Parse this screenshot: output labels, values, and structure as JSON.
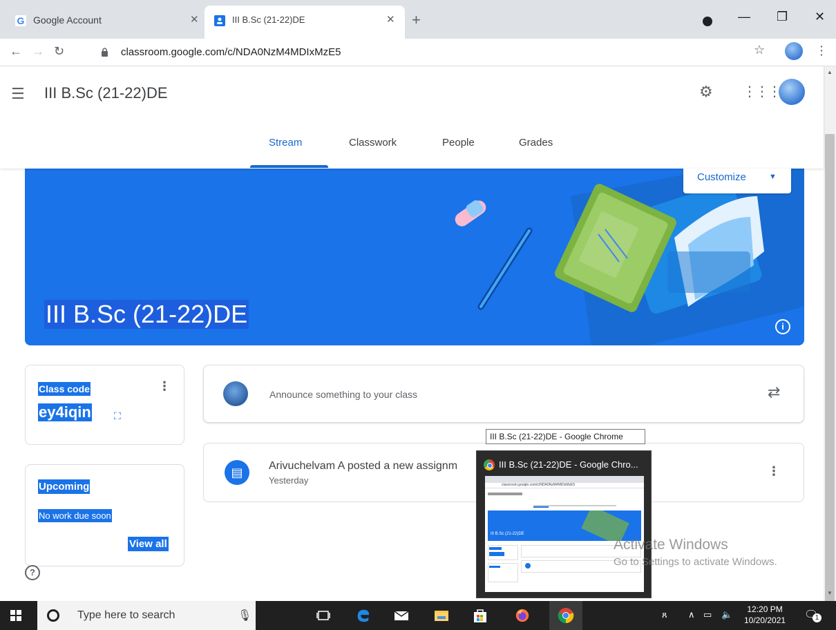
{
  "browser": {
    "tabs": [
      {
        "title": "Google Account",
        "close": "✕"
      },
      {
        "title": "III B.Sc (21-22)DE",
        "close": "✕"
      }
    ],
    "new_tab": "+",
    "url": "classroom.google.com/c/NDA0NzM4MDIxMzE5"
  },
  "header": {
    "class_title": "III B.Sc (21-22)DE",
    "tabs": [
      "Stream",
      "Classwork",
      "People",
      "Grades"
    ],
    "active_tab": "Stream"
  },
  "banner": {
    "title": "III B.Sc (21-22)DE",
    "customize_label": "Customize",
    "accent_color": "#1a73e8"
  },
  "class_code": {
    "label": "Class code",
    "value": "ey4iqin"
  },
  "upcoming": {
    "title": "Upcoming",
    "text": "No work due soon",
    "link": "View all"
  },
  "announce": {
    "placeholder": "Announce something to your class"
  },
  "post": {
    "title": "Arivuchelvam A posted a new assignm",
    "time": "Yesterday"
  },
  "tooltip": "III B.Sc (21-22)DE - Google Chrome",
  "thumbnail": {
    "title": "III B.Sc (21-22)DE - Google Chro...",
    "mini_url": "classroom.google.com/c/NDA0NzM4MDIxMzE5",
    "mini_banner_title": "III B.Sc (21-22)DE"
  },
  "watermark": {
    "line1": "Activate Windows",
    "line2": "Go to Settings to activate Windows."
  },
  "taskbar": {
    "search_placeholder": "Type here to search",
    "time": "12:20 PM",
    "date": "10/20/2021",
    "notifications": "1"
  }
}
